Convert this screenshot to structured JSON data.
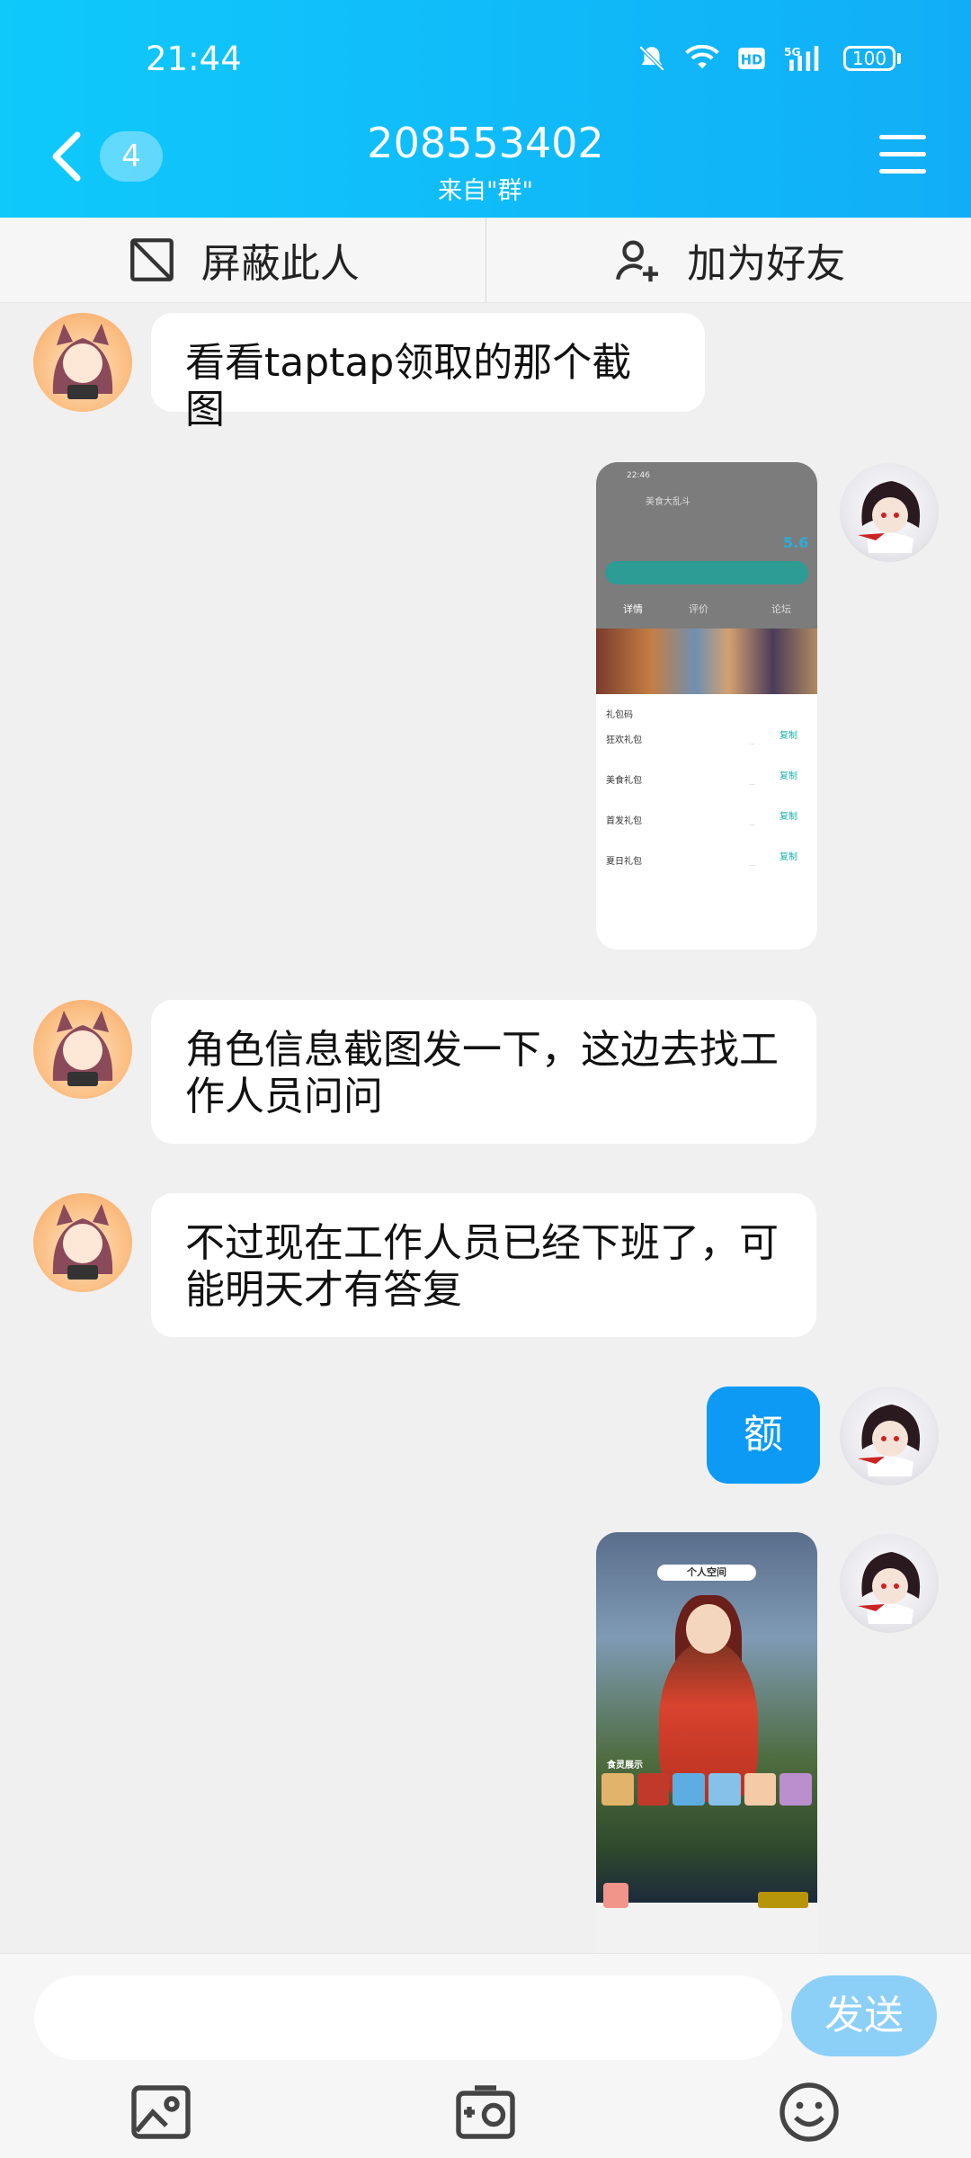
{
  "status_bar": {
    "time": "21:44",
    "battery": "100",
    "icons": [
      "mute-bell-icon",
      "wifi-icon",
      "hd-icon",
      "5g-signal-icon",
      "battery-icon"
    ]
  },
  "header": {
    "title": "208553402",
    "subtitle": "来自\"群\"",
    "unread_count": "4",
    "accent": "#11aef7"
  },
  "actions": {
    "block_label": "屏蔽此人",
    "add_friend_label": "加为好友"
  },
  "messages": [
    {
      "side": "left",
      "type": "text",
      "text": "看看taptap领取的那个截图"
    },
    {
      "side": "right",
      "type": "image",
      "image": {
        "time": "22:46",
        "header_title": "美食大乱斗",
        "rating": "5.6",
        "tabs": [
          "详情",
          "评价",
          "论坛"
        ],
        "section": "礼包码",
        "gifts": [
          "狂欢礼包",
          "美食礼包",
          "首发礼包",
          "夏日礼包"
        ],
        "copy_label": "复制"
      }
    },
    {
      "side": "left",
      "type": "text",
      "text": "角色信息截图发一下，这边去找工作人员问问"
    },
    {
      "side": "left",
      "type": "text",
      "text": "不过现在工作人员已经下班了，可能明天才有答复"
    },
    {
      "side": "right",
      "type": "text",
      "text": "额"
    },
    {
      "side": "right",
      "type": "image",
      "image": {
        "title": "个人空间",
        "section": "食灵展示"
      }
    }
  ],
  "input": {
    "placeholder": "",
    "send_label": "发送"
  },
  "toolbar": {
    "icons": [
      "photo-icon",
      "camera-icon",
      "emoji-icon"
    ]
  }
}
